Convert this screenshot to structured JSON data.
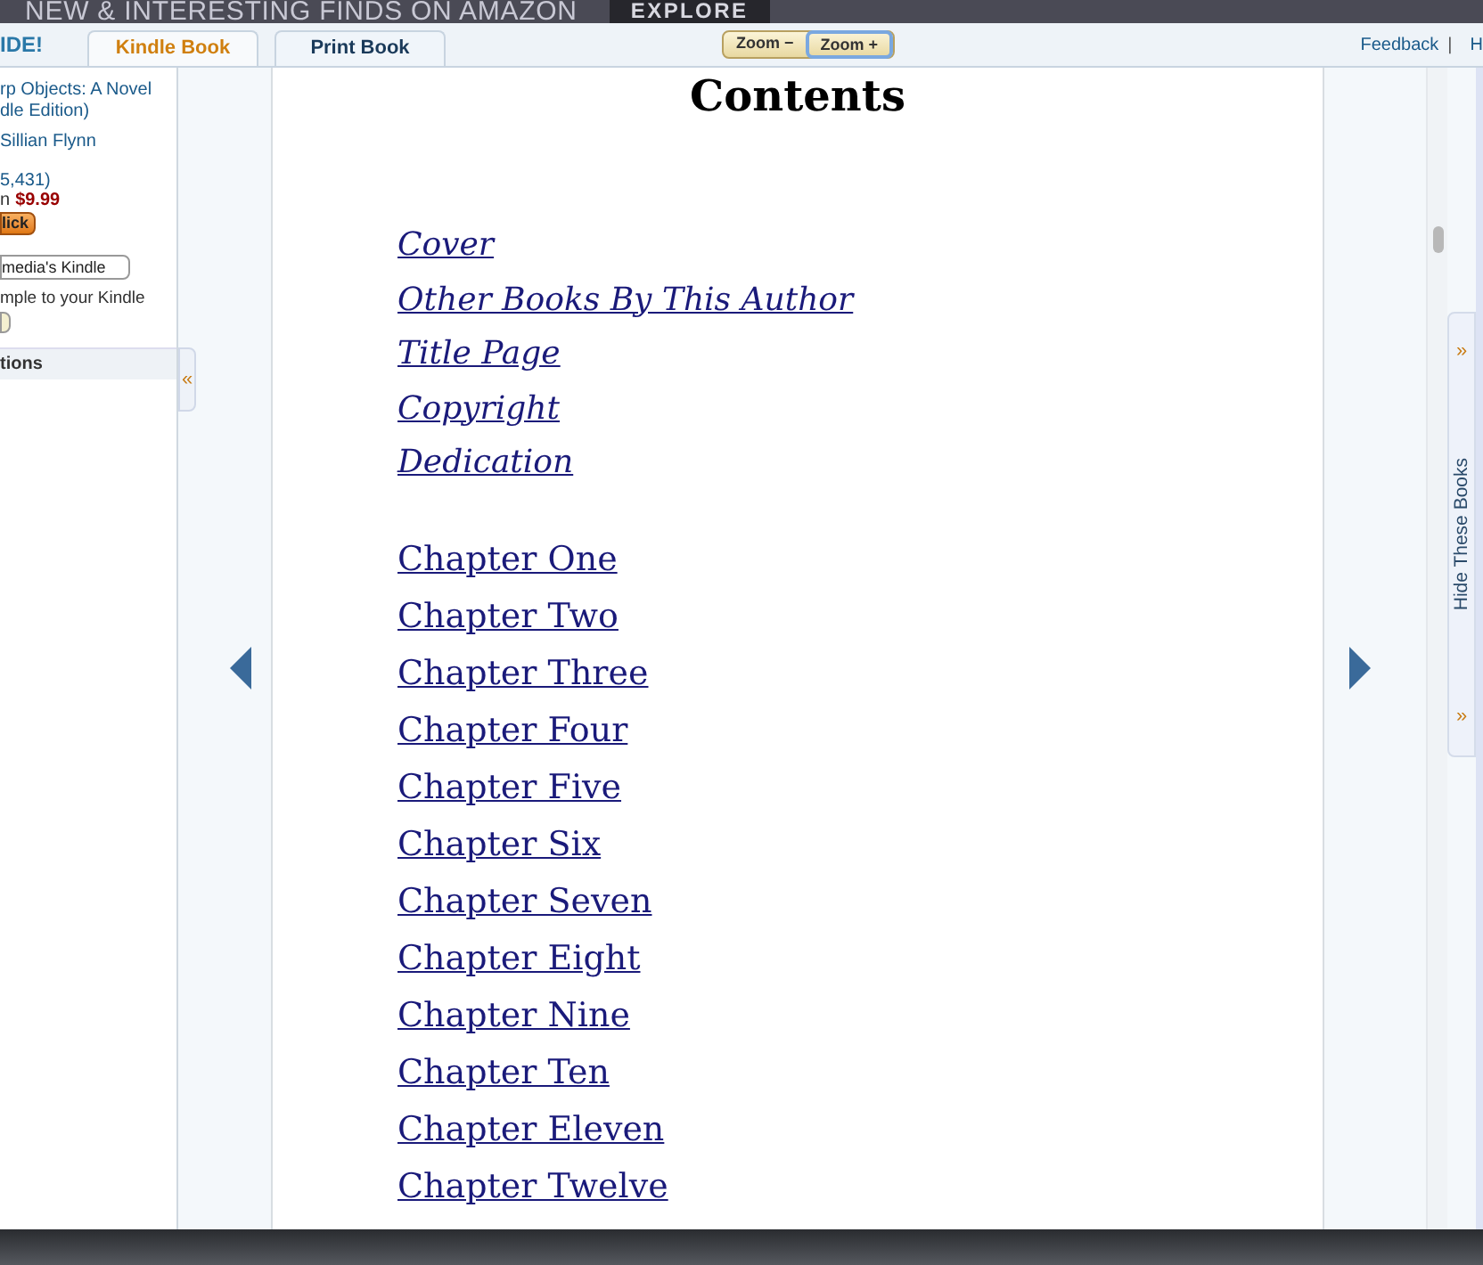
{
  "banner": {
    "text": "NEW & INTERESTING FINDS ON AMAZON",
    "button": "EXPLORE"
  },
  "toolbar": {
    "brand": "IDE!",
    "tabs": [
      {
        "label": "Kindle Book",
        "selected": true
      },
      {
        "label": "Print Book",
        "selected": false
      }
    ],
    "zoom_out": "Zoom −",
    "zoom_in": "Zoom +",
    "links": [
      "Feedback",
      "|",
      "H"
    ]
  },
  "sidebar": {
    "title_lines": [
      "rp Objects: A Novel",
      "dle Edition)"
    ],
    "author": "Sillian Flynn",
    "reviews": "5,431)",
    "price_prefix": "n",
    "price": "$9.99",
    "buy_button": "lick",
    "device_select": "media's Kindle",
    "sample_text": "mple to your Kindle",
    "section": "tions",
    "collapse": "«"
  },
  "book": {
    "heading": "Contents",
    "toc": [
      {
        "kind": "front",
        "label": "Cover"
      },
      {
        "kind": "front",
        "label": "Other Books By This Author"
      },
      {
        "kind": "front",
        "label": "Title Page"
      },
      {
        "kind": "front",
        "label": "Copyright"
      },
      {
        "kind": "front",
        "label": "Dedication"
      },
      {
        "kind": "chapter",
        "label": "Chapter One"
      },
      {
        "kind": "chapter",
        "label": "Chapter Two"
      },
      {
        "kind": "chapter",
        "label": "Chapter Three"
      },
      {
        "kind": "chapter",
        "label": "Chapter Four"
      },
      {
        "kind": "chapter",
        "label": "Chapter Five"
      },
      {
        "kind": "chapter",
        "label": "Chapter Six"
      },
      {
        "kind": "chapter",
        "label": "Chapter Seven"
      },
      {
        "kind": "chapter",
        "label": "Chapter Eight"
      },
      {
        "kind": "chapter",
        "label": "Chapter Nine"
      },
      {
        "kind": "chapter",
        "label": "Chapter Ten"
      },
      {
        "kind": "chapter",
        "label": "Chapter Eleven"
      },
      {
        "kind": "chapter",
        "label": "Chapter Twelve"
      }
    ]
  },
  "side_tab": {
    "label": "Hide These Books",
    "arrows": [
      "»",
      "»"
    ]
  }
}
